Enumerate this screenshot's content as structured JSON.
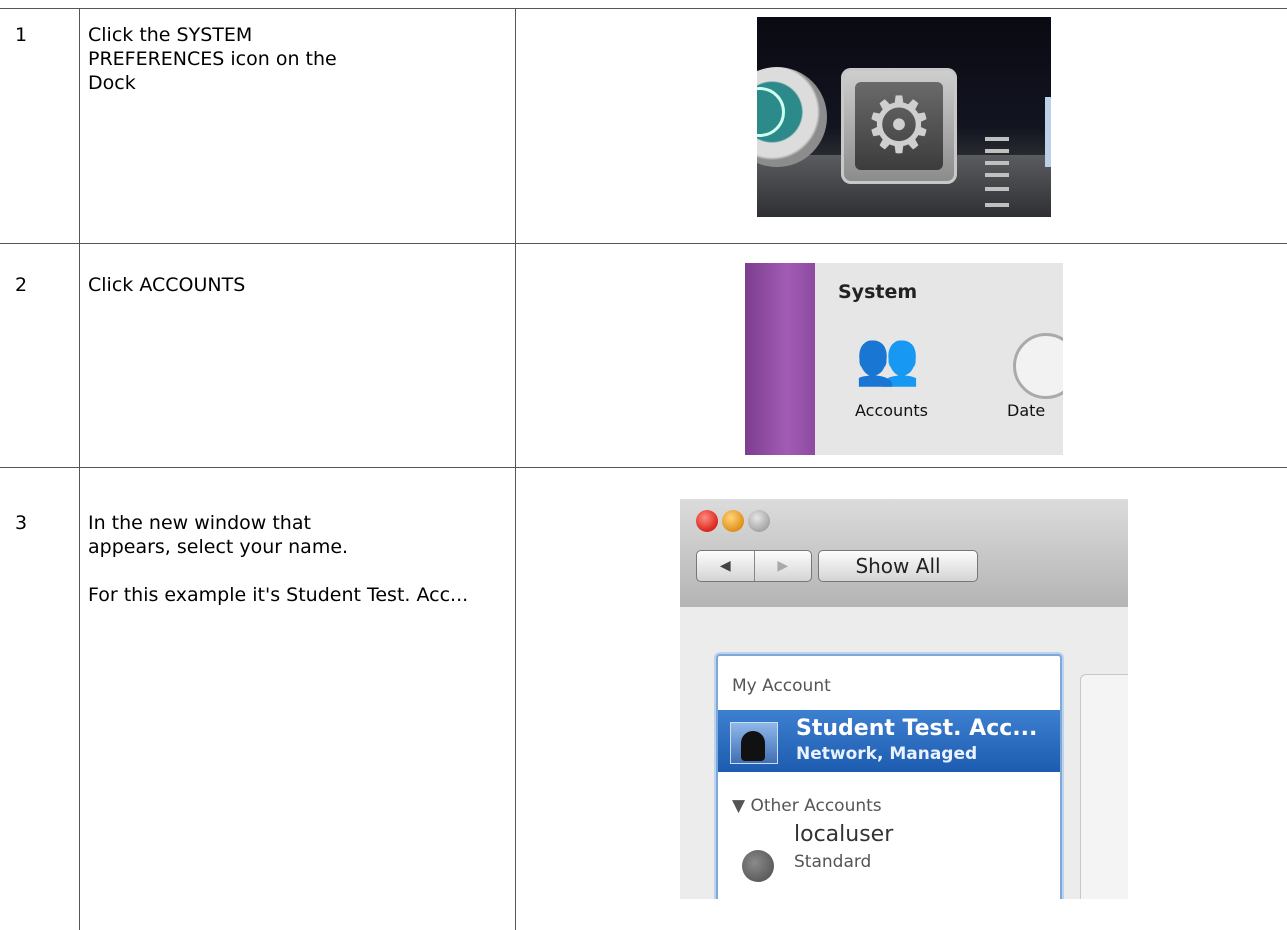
{
  "steps": [
    {
      "number": "1",
      "instruction": [
        "Click the SYSTEM PREFERENCES icon on the Dock"
      ]
    },
    {
      "number": "2",
      "instruction": [
        "Click ACCOUNTS"
      ]
    },
    {
      "number": "3",
      "instruction": [
        "In the new window that appears, select your name.",
        "For this example it's Student Test. Acc..."
      ]
    }
  ],
  "screenshot_2": {
    "section_title": "System",
    "accounts_label": "Accounts",
    "date_label": "Date"
  },
  "screenshot_3": {
    "nav_back": "◀",
    "nav_forward": "▶",
    "show_all_label": "Show All",
    "my_account_header": "My Account",
    "selected_name": "Student Test. Acc...",
    "selected_type": "Network, Managed",
    "other_accounts_header": "▼ Other Accounts",
    "local_user_name": "localuser",
    "local_user_type": "Standard"
  }
}
